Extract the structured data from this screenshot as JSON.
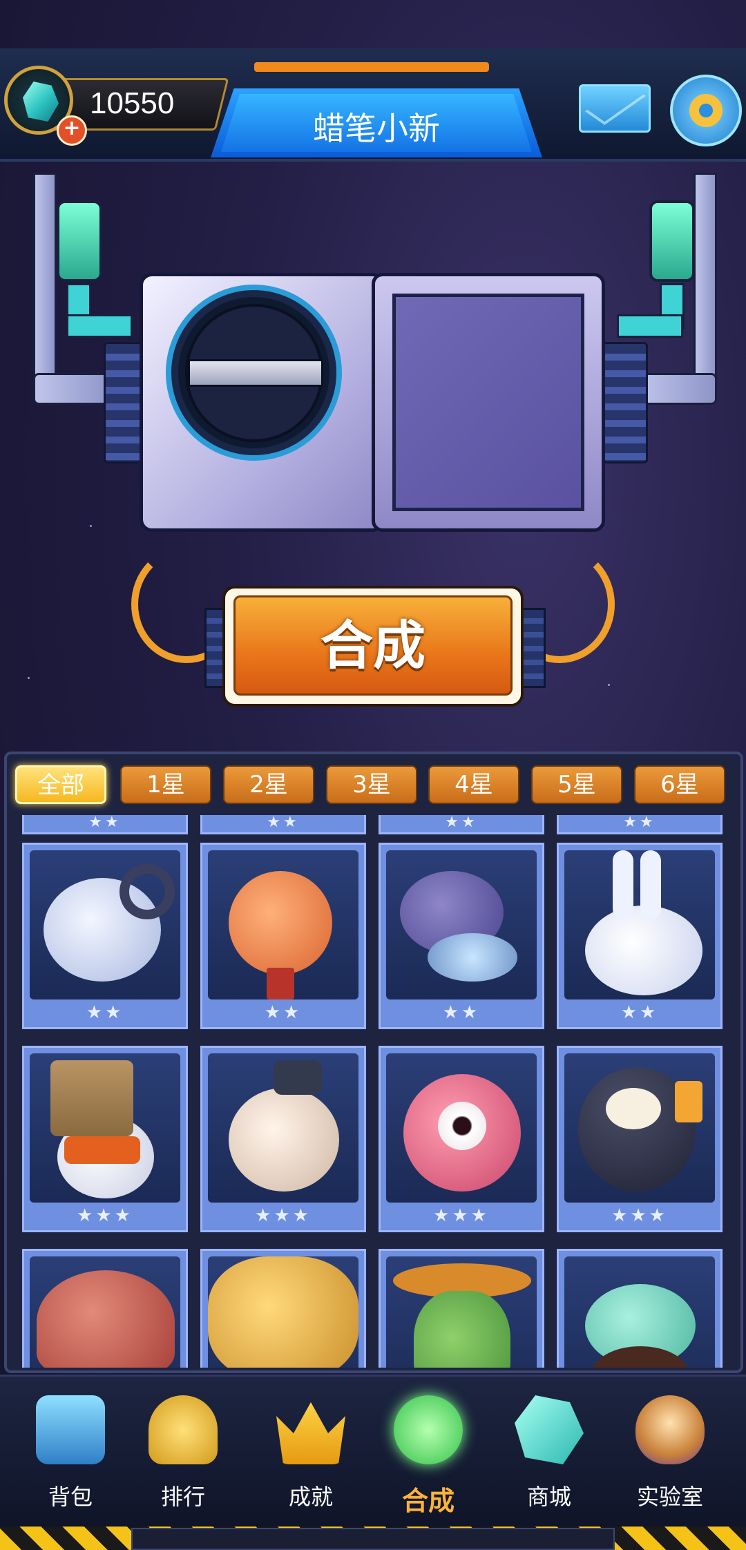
{
  "header": {
    "gem_count": "10550",
    "title": "蜡笔小新"
  },
  "craft": {
    "button_label": "合成"
  },
  "filter_tabs": [
    {
      "label": "全部",
      "active": true
    },
    {
      "label": "1星",
      "active": false
    },
    {
      "label": "2星",
      "active": false
    },
    {
      "label": "3星",
      "active": false
    },
    {
      "label": "4星",
      "active": false
    },
    {
      "label": "5星",
      "active": false
    },
    {
      "label": "6星",
      "active": false
    }
  ],
  "collection": {
    "row_partial_top": [
      "★★",
      "★★",
      "★★",
      "★★"
    ],
    "rows": [
      [
        {
          "creature": "white-ram",
          "stars": "★★"
        },
        {
          "creature": "lantern-spirit",
          "stars": "★★"
        },
        {
          "creature": "purple-dragon",
          "stars": "★★"
        },
        {
          "creature": "white-rabbit",
          "stars": "★★"
        }
      ],
      [
        {
          "creature": "bag-head-cat",
          "stars": "★★★"
        },
        {
          "creature": "hat-bird",
          "stars": "★★★"
        },
        {
          "creature": "eyeball-fish",
          "stars": "★★★"
        },
        {
          "creature": "penguin-juice",
          "stars": "★★★"
        }
      ],
      [
        {
          "creature": "red-mushroom",
          "stars": ""
        },
        {
          "creature": "yellow-fluff",
          "stars": ""
        },
        {
          "creature": "cactus-sombrero",
          "stars": ""
        },
        {
          "creature": "green-winged-blob",
          "stars": ""
        }
      ]
    ]
  },
  "nav": [
    {
      "label": "背包",
      "icon": "backpack-icon",
      "active": false
    },
    {
      "label": "排行",
      "icon": "trophy-icon",
      "active": false
    },
    {
      "label": "成就",
      "icon": "crown-icon",
      "active": false
    },
    {
      "label": "合成",
      "icon": "potion-icon",
      "active": true
    },
    {
      "label": "商城",
      "icon": "shop-crystal-icon",
      "active": false
    },
    {
      "label": "实验室",
      "icon": "egg-icon",
      "active": false
    }
  ],
  "colors": {
    "accent_orange": "#e9761a",
    "title_blue": "#1473e6",
    "active_tab": "#f5b820",
    "card_blue": "#6f8fe0"
  }
}
